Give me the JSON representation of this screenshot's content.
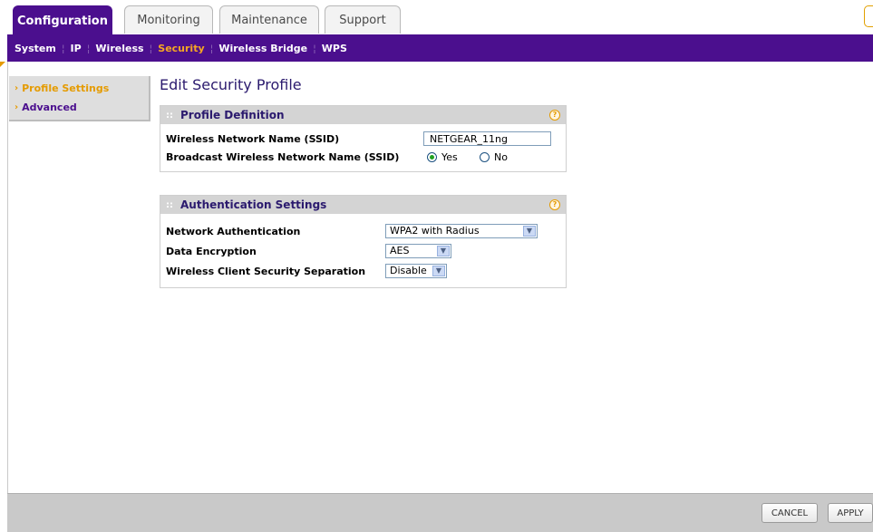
{
  "tabs": [
    {
      "label": "Configuration",
      "active": true
    },
    {
      "label": "Monitoring",
      "active": false
    },
    {
      "label": "Maintenance",
      "active": false
    },
    {
      "label": "Support",
      "active": false
    }
  ],
  "submenu": [
    {
      "label": "System",
      "active": false
    },
    {
      "label": "IP",
      "active": false
    },
    {
      "label": "Wireless",
      "active": false
    },
    {
      "label": "Security",
      "active": true
    },
    {
      "label": "Wireless Bridge",
      "active": false
    },
    {
      "label": "WPS",
      "active": false
    }
  ],
  "leftmenu": [
    {
      "label": "Profile Settings",
      "active": true
    },
    {
      "label": "Advanced",
      "active": false
    }
  ],
  "page_title": "Edit Security Profile",
  "profile_definition": {
    "header": "Profile Definition",
    "ssid_label": "Wireless Network Name (SSID)",
    "ssid_value": "NETGEAR_11ng",
    "broadcast_label": "Broadcast Wireless Network Name (SSID)",
    "yes_label": "Yes",
    "no_label": "No",
    "broadcast_selected": "Yes"
  },
  "authentication_settings": {
    "header": "Authentication Settings",
    "network_auth_label": "Network Authentication",
    "network_auth_value": "WPA2 with Radius",
    "data_encryption_label": "Data Encryption",
    "data_encryption_value": "AES",
    "separation_label": "Wireless Client Security Separation",
    "separation_value": "Disable"
  },
  "footer": {
    "cancel_label": "CANCEL",
    "apply_label": "APPLY"
  },
  "colors": {
    "brand_purple": "#4b0f8e",
    "accent_orange": "#e59b00"
  }
}
